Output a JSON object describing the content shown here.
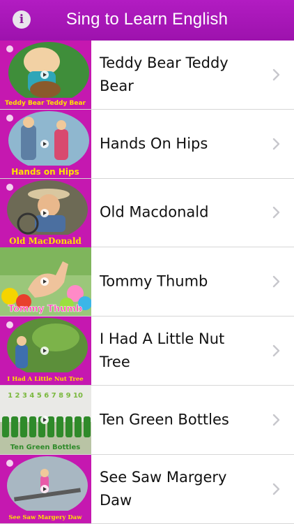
{
  "header": {
    "title": "Sing to Learn English",
    "info_icon": "info-icon",
    "info_glyph": "i",
    "color": "#a815b8"
  },
  "songs": [
    {
      "title": "Teddy Bear Teddy Bear",
      "thumb_caption": "Teddy Bear Teddy Bear"
    },
    {
      "title": "Hands On Hips",
      "thumb_caption": "Hands on Hips"
    },
    {
      "title": "Old Macdonald",
      "thumb_caption": "Old MacDonald"
    },
    {
      "title": "Tommy Thumb",
      "thumb_caption": "Tommy Thumb"
    },
    {
      "title": "I Had A Little Nut Tree",
      "thumb_caption": "I Had A Little Nut Tree"
    },
    {
      "title": "Ten Green Bottles",
      "thumb_caption": "Ten Green Bottles",
      "thumb_numbers": "1 2 3 4 5 6 7 8 9 10"
    },
    {
      "title": "See Saw Margery Daw",
      "thumb_caption": "See Saw Margery Daw"
    }
  ],
  "icons": {
    "row_chevron": "chevron-right-icon",
    "play": "play-icon"
  }
}
